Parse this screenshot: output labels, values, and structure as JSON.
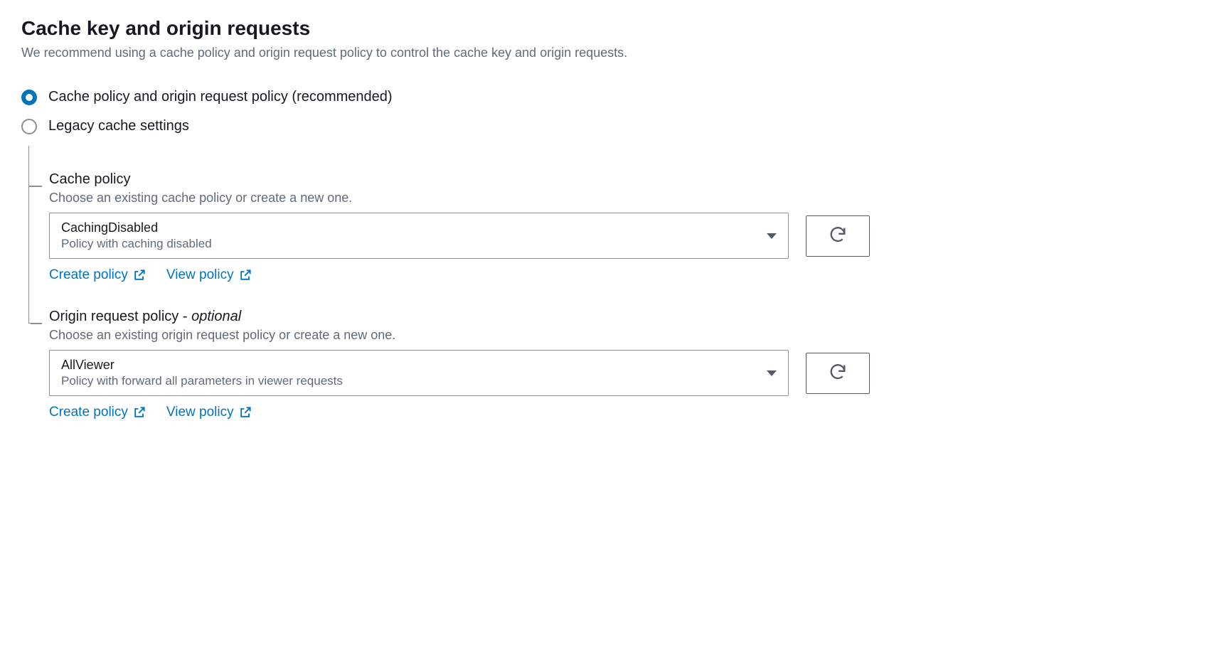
{
  "heading": "Cache key and origin requests",
  "description": "We recommend using a cache policy and origin request policy to control the cache key and origin requests.",
  "radio": {
    "option1": "Cache policy and origin request policy (recommended)",
    "option2": "Legacy cache settings"
  },
  "cachePolicy": {
    "label": "Cache policy",
    "description": "Choose an existing cache policy or create a new one.",
    "selectedValue": "CachingDisabled",
    "selectedSubtext": "Policy with caching disabled",
    "createLink": "Create policy",
    "viewLink": "View policy"
  },
  "originRequestPolicy": {
    "labelMain": "Origin request policy ",
    "labelDash": "- ",
    "labelOptional": "optional",
    "description": "Choose an existing origin request policy or create a new one.",
    "selectedValue": "AllViewer",
    "selectedSubtext": "Policy with forward all parameters in viewer requests",
    "createLink": "Create policy",
    "viewLink": "View policy"
  }
}
